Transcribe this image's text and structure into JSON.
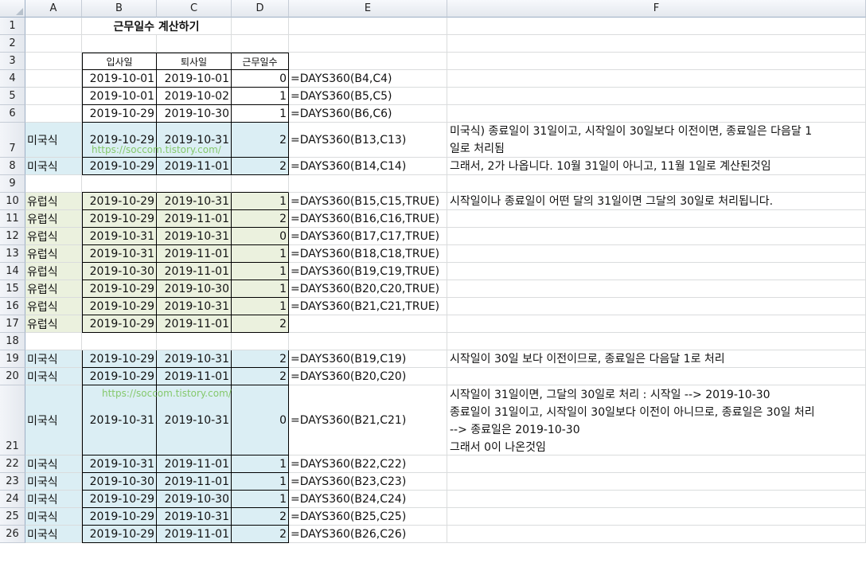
{
  "columns": [
    "A",
    "B",
    "C",
    "D",
    "E",
    "F"
  ],
  "title": "근무일수 계산하기",
  "headers": {
    "start": "입사일",
    "end": "퇴사일",
    "days": "근무일수"
  },
  "rows": [
    {
      "n": "1"
    },
    {
      "n": "2"
    },
    {
      "n": "3"
    },
    {
      "n": "4",
      "b": "2019-10-01",
      "c": "2019-10-01",
      "d": "0",
      "e": "=DAYS360(B4,C4)"
    },
    {
      "n": "5",
      "b": "2019-10-01",
      "c": "2019-10-02",
      "d": "1",
      "e": "=DAYS360(B5,C5)"
    },
    {
      "n": "6",
      "b": "2019-10-29",
      "c": "2019-10-30",
      "d": "1",
      "e": "=DAYS360(B6,C6)"
    },
    {
      "n": "7",
      "a": "미국식",
      "b": "2019-10-29",
      "c": "2019-10-31",
      "d": "2",
      "e": "=DAYS360(B13,C13)"
    },
    {
      "n": "8",
      "a": "미국식",
      "b": "2019-10-29",
      "c": "2019-11-01",
      "d": "2",
      "e": "=DAYS360(B14,C14)"
    },
    {
      "n": "9"
    },
    {
      "n": "10",
      "a": "유럽식",
      "b": "2019-10-29",
      "c": "2019-10-31",
      "d": "1",
      "e": "=DAYS360(B15,C15,TRUE)"
    },
    {
      "n": "11",
      "a": "유럽식",
      "b": "2019-10-29",
      "c": "2019-11-01",
      "d": "2",
      "e": "=DAYS360(B16,C16,TRUE)"
    },
    {
      "n": "12",
      "a": "유럽식",
      "b": "2019-10-31",
      "c": "2019-10-31",
      "d": "0",
      "e": "=DAYS360(B17,C17,TRUE)"
    },
    {
      "n": "13",
      "a": "유럽식",
      "b": "2019-10-31",
      "c": "2019-11-01",
      "d": "1",
      "e": "=DAYS360(B18,C18,TRUE)"
    },
    {
      "n": "14",
      "a": "유럽식",
      "b": "2019-10-30",
      "c": "2019-11-01",
      "d": "1",
      "e": "=DAYS360(B19,C19,TRUE)"
    },
    {
      "n": "15",
      "a": "유럽식",
      "b": "2019-10-29",
      "c": "2019-10-30",
      "d": "1",
      "e": "=DAYS360(B20,C20,TRUE)"
    },
    {
      "n": "16",
      "a": "유럽식",
      "b": "2019-10-29",
      "c": "2019-10-31",
      "d": "1",
      "e": "=DAYS360(B21,C21,TRUE)"
    },
    {
      "n": "17",
      "a": "유럽식",
      "b": "2019-10-29",
      "c": "2019-11-01",
      "d": "2"
    },
    {
      "n": "18"
    },
    {
      "n": "19",
      "a": "미국식",
      "b": "2019-10-29",
      "c": "2019-10-31",
      "d": "2",
      "e": "=DAYS360(B19,C19)"
    },
    {
      "n": "20",
      "a": "미국식",
      "b": "2019-10-29",
      "c": "2019-11-01",
      "d": "2",
      "e": "=DAYS360(B20,C20)"
    },
    {
      "n": "21",
      "a": "미국식",
      "b": "2019-10-31",
      "c": "2019-10-31",
      "d": "0",
      "e": "=DAYS360(B21,C21)"
    },
    {
      "n": "22",
      "a": "미국식",
      "b": "2019-10-31",
      "c": "2019-11-01",
      "d": "1",
      "e": "=DAYS360(B22,C22)"
    },
    {
      "n": "23",
      "a": "미국식",
      "b": "2019-10-30",
      "c": "2019-11-01",
      "d": "1",
      "e": "=DAYS360(B23,C23)"
    },
    {
      "n": "24",
      "a": "미국식",
      "b": "2019-10-29",
      "c": "2019-10-30",
      "d": "1",
      "e": "=DAYS360(B24,C24)"
    },
    {
      "n": "25",
      "a": "미국식",
      "b": "2019-10-29",
      "c": "2019-10-31",
      "d": "2",
      "e": "=DAYS360(B25,C25)"
    },
    {
      "n": "26",
      "a": "미국식",
      "b": "2019-10-29",
      "c": "2019-11-01",
      "d": "2",
      "e": "=DAYS360(B26,C26)"
    }
  ],
  "notes": {
    "r7": [
      "미국식) 종료일이 31일이고, 시작일이 30일보다 이전이면, 종료일은 다음달 1",
      "일로 처리됨",
      "그래서, 2가 나옵니다. 10월 31일이 아니고, 11월 1일로 계산된것임"
    ],
    "r10": [
      "시작일이나 종료일이 어떤 달의 31일이면 그달의 30일로 처리됩니다."
    ],
    "r19": [
      "시작일이 30일 보다 이전이므로, 종료일은 다음달 1로 처리"
    ],
    "r21": [
      "시작일이 31일이면, 그달의 30일로 처리 : 시작일 --> 2019-10-30",
      "종료일이 31일이고, 시작일이 30일보다 이전이 아니므로, 종료일은 30일 처리",
      "--> 종료일은 2019-10-30",
      "그래서 0이 나온것임"
    ]
  },
  "watermark": "https://soccom.tistory.com/",
  "colors": {
    "american_fill": "#dbeef4",
    "european_fill": "#ebf1de"
  }
}
